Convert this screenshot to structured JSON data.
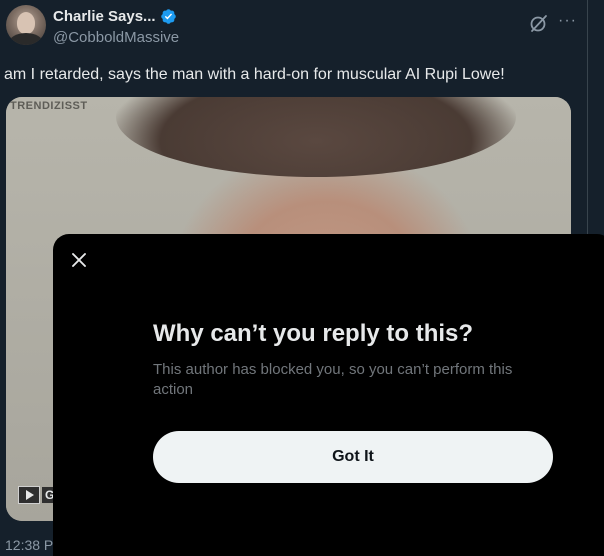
{
  "tweet": {
    "display_name": "Charlie Says...",
    "handle": "@CobboldMassive",
    "text": "am I retarded, says the man with a hard-on for muscular AI Rupi Lowe!",
    "timestamp": "12:38 P",
    "verified_badge": "verified-icon",
    "media": {
      "watermark": "TRENDIZISST",
      "label": "G"
    }
  },
  "modal": {
    "title": "Why can’t you reply to this?",
    "body": "This author has blocked you, so you can’t perform this action",
    "button_label": "Got It"
  },
  "colors": {
    "background": "#15202b",
    "modal_bg": "#000000",
    "button_bg": "#eff3f4",
    "verified": "#1d9bf0",
    "muted_text": "#71767b"
  }
}
